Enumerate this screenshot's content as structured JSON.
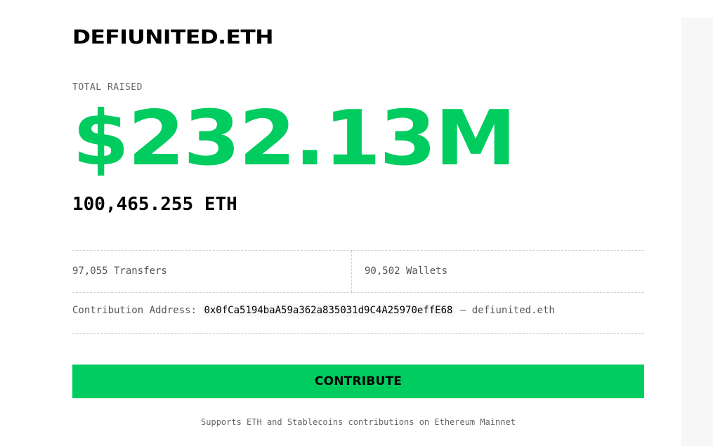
{
  "header": {
    "brand": "DEFIUNITED.ETH"
  },
  "totals": {
    "label": "TOTAL RAISED",
    "usd": "$232.13M",
    "eth": "100,465.255 ETH"
  },
  "stats": {
    "transfers": "97,055 Transfers",
    "wallets": "90,502 Wallets"
  },
  "contribution": {
    "label": "Contribution Address:",
    "address": "0x0fCa5194baA59a362a835031d9C4A25970effE68",
    "separator": "—",
    "ens": "defiunited.eth"
  },
  "cta": {
    "label": "CONTRIBUTE"
  },
  "footer": {
    "note": "Supports ETH and Stablecoins contributions on Ethereum Mainnet"
  },
  "colors": {
    "accent": "#00cc5f",
    "text": "#000000",
    "muted": "#666666"
  }
}
